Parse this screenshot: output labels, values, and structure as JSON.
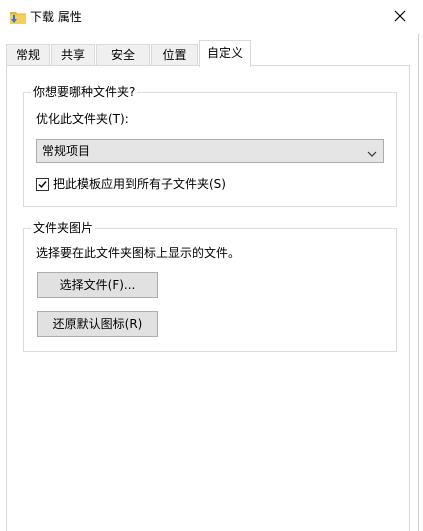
{
  "window": {
    "title": "下载 属性",
    "title_icon": "folder-download-icon",
    "close_icon": "close-icon"
  },
  "tabs": [
    {
      "label": "常规",
      "active": false
    },
    {
      "label": "共享",
      "active": false
    },
    {
      "label": "安全",
      "active": false
    },
    {
      "label": "位置",
      "active": false
    },
    {
      "label": "自定义",
      "active": true
    }
  ],
  "folder_type_group": {
    "legend": "你想要哪种文件夹?",
    "optimize_label": "优化此文件夹(T):",
    "optimize_select": {
      "value": "常规项目"
    },
    "apply_checkbox": {
      "checked": true,
      "label": "把此模板应用到所有子文件夹(S)"
    }
  },
  "folder_picture_group": {
    "legend": "文件夹图片",
    "description": "选择要在此文件夹图标上显示的文件。",
    "choose_file_button": "选择文件(F)...",
    "restore_icon_button": "还原默认图标(R)"
  },
  "colors": {
    "window_bg": "#ffffff",
    "tab_inactive_bg": "#f0f0f0",
    "border": "#d9d9d9",
    "button_bg": "#e1e1e1",
    "select_bg": "#e5e5e5",
    "folder_yellow": "#e8b13a",
    "download_arrow": "#2b79d6"
  }
}
